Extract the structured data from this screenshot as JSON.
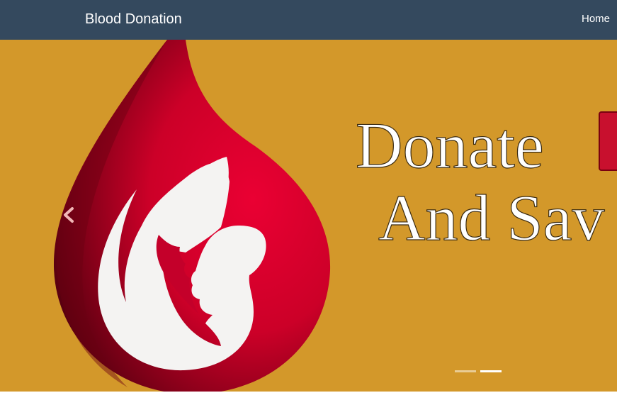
{
  "navbar": {
    "brand": "Blood Donation",
    "links": [
      {
        "label": "Home"
      }
    ],
    "background": "#34495e"
  },
  "carousel": {
    "background": "#d3982a",
    "slide": {
      "headline_line1": "Donate",
      "headline_line2": "And Sav",
      "drop_color": "#e4002b",
      "drop_shadow_color": "#6a0010"
    },
    "controls": {
      "prev_icon": "chevron-left-icon"
    },
    "indicators": [
      {
        "active": false
      },
      {
        "active": true
      }
    ]
  }
}
